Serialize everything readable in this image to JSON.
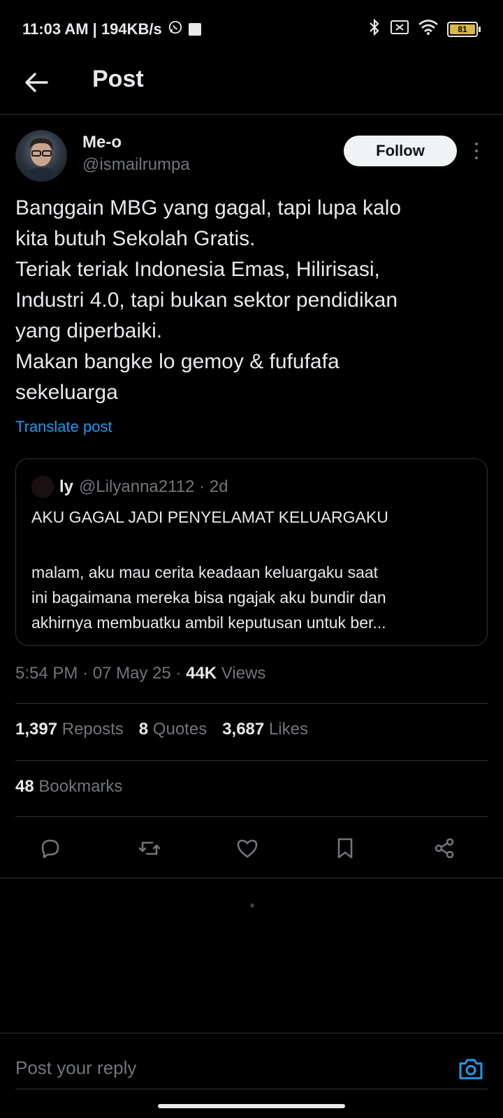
{
  "status_bar": {
    "time_speed": "11:03 AM | 194KB/s",
    "battery": "81"
  },
  "header": {
    "title": "Post"
  },
  "post": {
    "author_name": "Me-o",
    "author_handle": "@ismailrumpa",
    "follow_label": "Follow",
    "body_lines": [
      "Banggain MBG yang gagal, tapi lupa kalo",
      "kita butuh Sekolah Gratis.",
      "Teriak teriak Indonesia Emas, Hilirisasi,",
      "Industri 4.0, tapi bukan sektor pendidikan",
      "yang diperbaiki.",
      "Makan bangke lo gemoy & fufufafa",
      "sekeluarga"
    ],
    "translate_label": "Translate post"
  },
  "quote": {
    "name": "ly",
    "handle_time": "@Lilyanna2112 · 2d",
    "title": "AKU GAGAL JADI PENYELAMAT KELUARGAKU",
    "text_lines": [
      "malam, aku mau cerita keadaan keluargaku saat",
      "ini bagaimana mereka bisa ngajak aku bundir dan",
      "akhirnya membuatku ambil keputusan untuk ber..."
    ]
  },
  "meta": {
    "timestamp": "5:54 PM · 07 May 25 · ",
    "views_count": "44K",
    "views_label": " Views"
  },
  "stats": {
    "reposts_count": "1,397",
    "reposts_label": " Reposts",
    "quotes_count": "8",
    "quotes_label": " Quotes",
    "likes_count": "3,687",
    "likes_label": " Likes",
    "bookmarks_count": "48",
    "bookmarks_label": " Bookmarks"
  },
  "actions": {
    "icons": [
      "reply-icon",
      "repost-icon",
      "like-icon",
      "bookmark-icon",
      "share-icon"
    ]
  },
  "reply_bar": {
    "placeholder": "Post your reply"
  },
  "colors": {
    "background": "#000000",
    "text": "#e7e9ea",
    "muted": "#71767b",
    "link": "#1d9bf0",
    "border": "#2f3336"
  }
}
